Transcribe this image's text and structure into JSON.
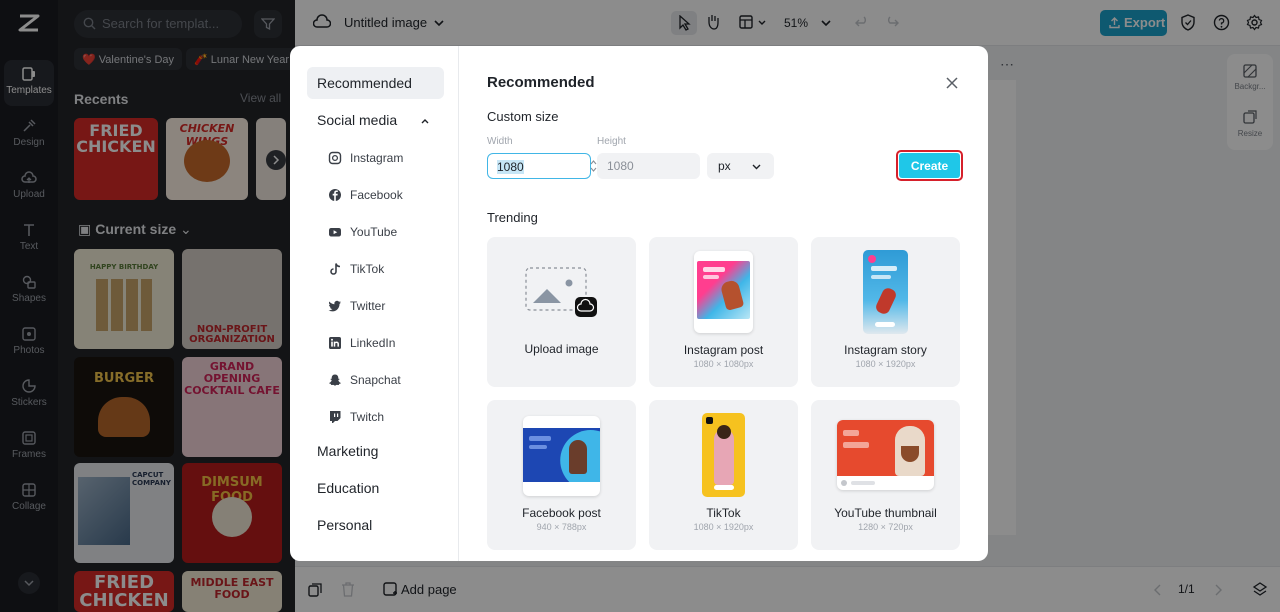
{
  "app": {
    "doc_title": "Untitled image",
    "zoom": "51%",
    "export_label": "Export",
    "add_page_label": "Add page",
    "page_indicator": "1/1",
    "accent": "#1aa2cc"
  },
  "rail": {
    "items": [
      {
        "label": "Templates",
        "icon": "templates-icon"
      },
      {
        "label": "Design",
        "icon": "design-icon"
      },
      {
        "label": "Upload",
        "icon": "upload-icon"
      },
      {
        "label": "Text",
        "icon": "text-icon"
      },
      {
        "label": "Shapes",
        "icon": "shapes-icon"
      },
      {
        "label": "Photos",
        "icon": "photos-icon"
      },
      {
        "label": "Stickers",
        "icon": "stickers-icon"
      },
      {
        "label": "Frames",
        "icon": "frames-icon"
      },
      {
        "label": "Collage",
        "icon": "collage-icon"
      }
    ]
  },
  "panel": {
    "search_placeholder": "Search for templat...",
    "chips": [
      "❤️ Valentine's Day",
      "🧨 Lunar New Year"
    ],
    "recents_title": "Recents",
    "view_all": "View all",
    "current_size_title": "Current size",
    "recent_thumbs": [
      "FRIED CHICKEN",
      "CHICKEN WINGS"
    ],
    "grid_thumbs": [
      "HAPPY BIRTHDAY",
      "NON-PROFIT ORGANIZATION",
      "BURGER",
      "GRAND OPENING COCKTAIL CAFE",
      "CAPCUT COMPANY",
      "DIMSUM FOOD",
      "FRIED CHICKEN",
      "MIDDLE EAST FOOD"
    ]
  },
  "right_tools": {
    "background_label": "Backgr...",
    "resize_label": "Resize"
  },
  "modal": {
    "title": "Recommended",
    "nav": {
      "recommended": "Recommended",
      "social_media": "Social media",
      "social_items": [
        "Instagram",
        "Facebook",
        "YouTube",
        "TikTok",
        "Twitter",
        "LinkedIn",
        "Snapchat",
        "Twitch"
      ],
      "marketing": "Marketing",
      "education": "Education",
      "personal": "Personal"
    },
    "custom_size_title": "Custom size",
    "width_label": "Width",
    "height_label": "Height",
    "width_value": "1080",
    "height_value": "1080",
    "unit": "px",
    "create_label": "Create",
    "trending_title": "Trending",
    "cards": [
      {
        "name": "Upload image",
        "size": ""
      },
      {
        "name": "Instagram post",
        "size": "1080 × 1080px"
      },
      {
        "name": "Instagram story",
        "size": "1080 × 1920px"
      },
      {
        "name": "Facebook post",
        "size": "940 × 788px"
      },
      {
        "name": "TikTok",
        "size": "1080 × 1920px"
      },
      {
        "name": "YouTube thumbnail",
        "size": "1280 × 720px"
      }
    ]
  }
}
